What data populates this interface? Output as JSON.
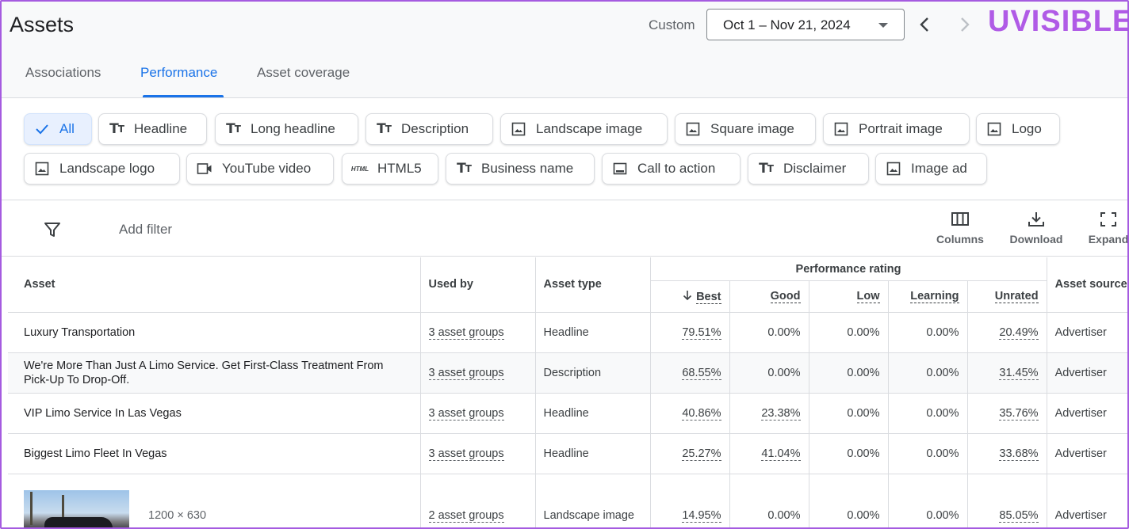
{
  "header": {
    "title": "Assets",
    "date_label": "Custom",
    "date_range": "Oct 1 – Nov 21, 2024",
    "logo_text": "UVISIBLE",
    "logo_color": "#b05be6"
  },
  "tabs": [
    {
      "label": "Associations"
    },
    {
      "label": "Performance",
      "selected": true
    },
    {
      "label": "Asset coverage"
    }
  ],
  "filters": {
    "chips": [
      {
        "label": "All",
        "icon": "check-icon",
        "selected": true
      },
      {
        "label": "Headline",
        "icon": "text-icon"
      },
      {
        "label": "Long headline",
        "icon": "text-icon"
      },
      {
        "label": "Description",
        "icon": "text-icon"
      },
      {
        "label": "Landscape image",
        "icon": "image-icon"
      },
      {
        "label": "Square image",
        "icon": "image-icon"
      },
      {
        "label": "Portrait image",
        "icon": "image-icon"
      },
      {
        "label": "Logo",
        "icon": "image-icon"
      },
      {
        "label": "Landscape logo",
        "icon": "image-icon"
      },
      {
        "label": "YouTube video",
        "icon": "video-icon"
      },
      {
        "label": "HTML5",
        "icon": "html-icon",
        "icon_text": "HTML"
      },
      {
        "label": "Business name",
        "icon": "text-icon"
      },
      {
        "label": "Call to action",
        "icon": "cta-icon"
      },
      {
        "label": "Disclaimer",
        "icon": "text-icon"
      },
      {
        "label": "Image ad",
        "icon": "image-icon"
      }
    ]
  },
  "toolbar": {
    "add_filter": "Add filter",
    "columns_label": "Columns",
    "download_label": "Download",
    "expand_label": "Expand"
  },
  "table": {
    "columns": {
      "asset": "Asset",
      "used_by": "Used by",
      "asset_type": "Asset type",
      "performance_group": "Performance rating",
      "best": "Best",
      "good": "Good",
      "low": "Low",
      "learning": "Learning",
      "unrated": "Unrated",
      "asset_source": "Asset source"
    },
    "rows": [
      {
        "asset": "Luxury Transportation",
        "used_by": "3 asset groups",
        "type": "Headline",
        "best": "79.51%",
        "good": "0.00%",
        "low": "0.00%",
        "learning": "0.00%",
        "unrated": "20.49%",
        "source": "Advertiser"
      },
      {
        "asset": "We're More Than Just A Limo Service. Get First-Class Treatment From Pick-Up To Drop-Off.",
        "used_by": "3 asset groups",
        "type": "Description",
        "best": "68.55%",
        "good": "0.00%",
        "low": "0.00%",
        "learning": "0.00%",
        "unrated": "31.45%",
        "source": "Advertiser"
      },
      {
        "asset": "VIP Limo Service In Las Vegas",
        "used_by": "3 asset groups",
        "type": "Headline",
        "best": "40.86%",
        "good": "23.38%",
        "low": "0.00%",
        "learning": "0.00%",
        "unrated": "35.76%",
        "source": "Advertiser"
      },
      {
        "asset": "Biggest Limo Fleet In Vegas",
        "used_by": "3 asset groups",
        "type": "Headline",
        "best": "25.27%",
        "good": "41.04%",
        "low": "0.00%",
        "learning": "0.00%",
        "unrated": "33.68%",
        "source": "Advertiser"
      },
      {
        "asset_dims": "1200 × 630",
        "used_by": "2 asset groups",
        "type": "Landscape image",
        "best": "14.95%",
        "good": "0.00%",
        "low": "0.00%",
        "learning": "0.00%",
        "unrated": "85.05%",
        "source": "Advertiser"
      }
    ]
  }
}
